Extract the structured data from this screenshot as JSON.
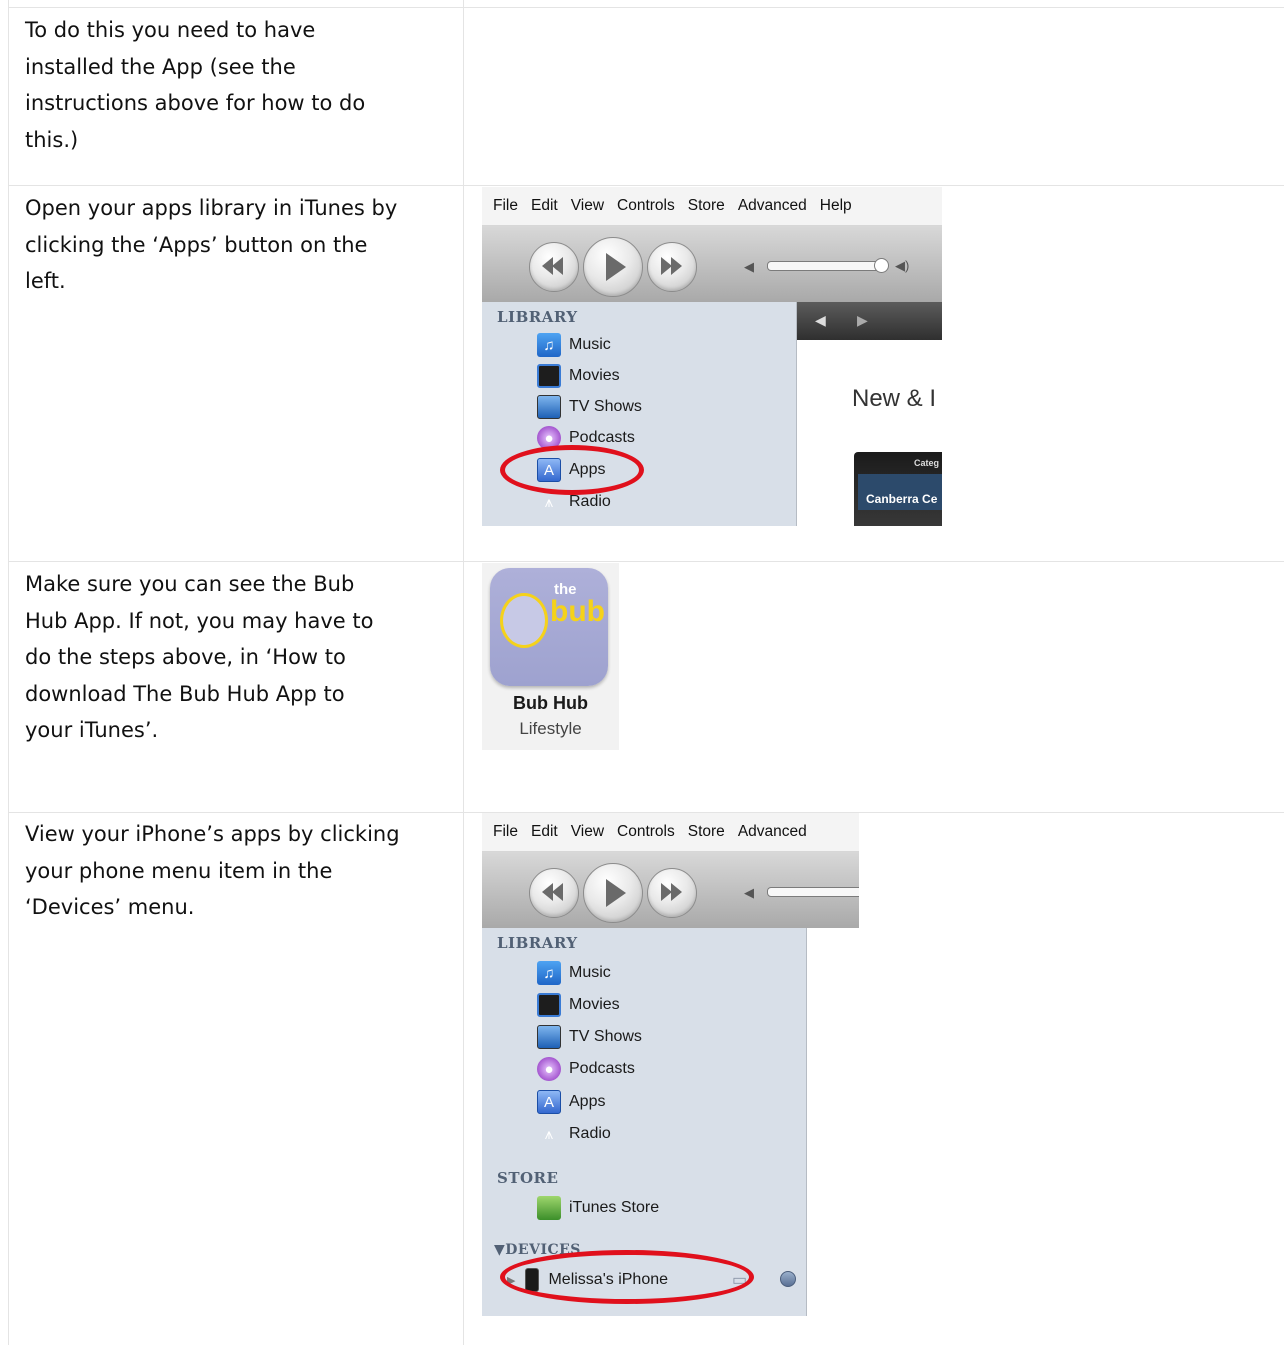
{
  "rows": [
    {
      "text_lines": [
        "To do this you need to have",
        "installed the App (see the",
        "instructions above for how to do",
        "this.)"
      ]
    },
    {
      "text_lines": [
        "Open your apps library in iTunes by",
        "clicking the ‘Apps’ button on the",
        "left."
      ]
    },
    {
      "text_lines": [
        "Make sure you can see the Bub",
        "Hub App. If not, you may have to",
        "do the steps above, in ‘How to",
        "download The Bub Hub App to",
        "your iTunes’."
      ]
    },
    {
      "text_lines": [
        "View your iPhone’s apps by clicking",
        "your phone menu item in the",
        "‘Devices’ menu."
      ]
    }
  ],
  "itunes_1": {
    "menu": [
      "File",
      "Edit",
      "View",
      "Controls",
      "Store",
      "Advanced",
      "Help"
    ],
    "library_heading": "LIBRARY",
    "library_items": [
      {
        "label": "Music",
        "icon": "music-note-icon"
      },
      {
        "label": "Movies",
        "icon": "film-icon"
      },
      {
        "label": "TV Shows",
        "icon": "tv-icon"
      },
      {
        "label": "Podcasts",
        "icon": "podcast-icon"
      },
      {
        "label": "Apps",
        "icon": "apps-icon"
      },
      {
        "label": "Radio",
        "icon": "radio-tower-icon"
      }
    ],
    "content_heading": "New & I",
    "preview_title": "Categ",
    "preview_subtitle": "Canberra Ce"
  },
  "app_tile": {
    "logo_small": "the",
    "logo_large": "bub",
    "name": "Bub Hub",
    "category": "Lifestyle"
  },
  "itunes_2": {
    "menu": [
      "File",
      "Edit",
      "View",
      "Controls",
      "Store",
      "Advanced"
    ],
    "library_heading": "LIBRARY",
    "library_items": [
      {
        "label": "Music",
        "icon": "music-note-icon"
      },
      {
        "label": "Movies",
        "icon": "film-icon"
      },
      {
        "label": "TV Shows",
        "icon": "tv-icon"
      },
      {
        "label": "Podcasts",
        "icon": "podcast-icon"
      },
      {
        "label": "Apps",
        "icon": "apps-icon"
      },
      {
        "label": "Radio",
        "icon": "radio-tower-icon"
      }
    ],
    "store_heading": "STORE",
    "store_items": [
      {
        "label": "iTunes Store",
        "icon": "store-icon"
      }
    ],
    "devices_heading": "▼DEVICES",
    "device_item": "Melissa's iPhone"
  },
  "colors": {
    "highlight_ellipse": "#e0101c",
    "sidebar": "#d8dfe8",
    "section_heading": "#526175"
  }
}
